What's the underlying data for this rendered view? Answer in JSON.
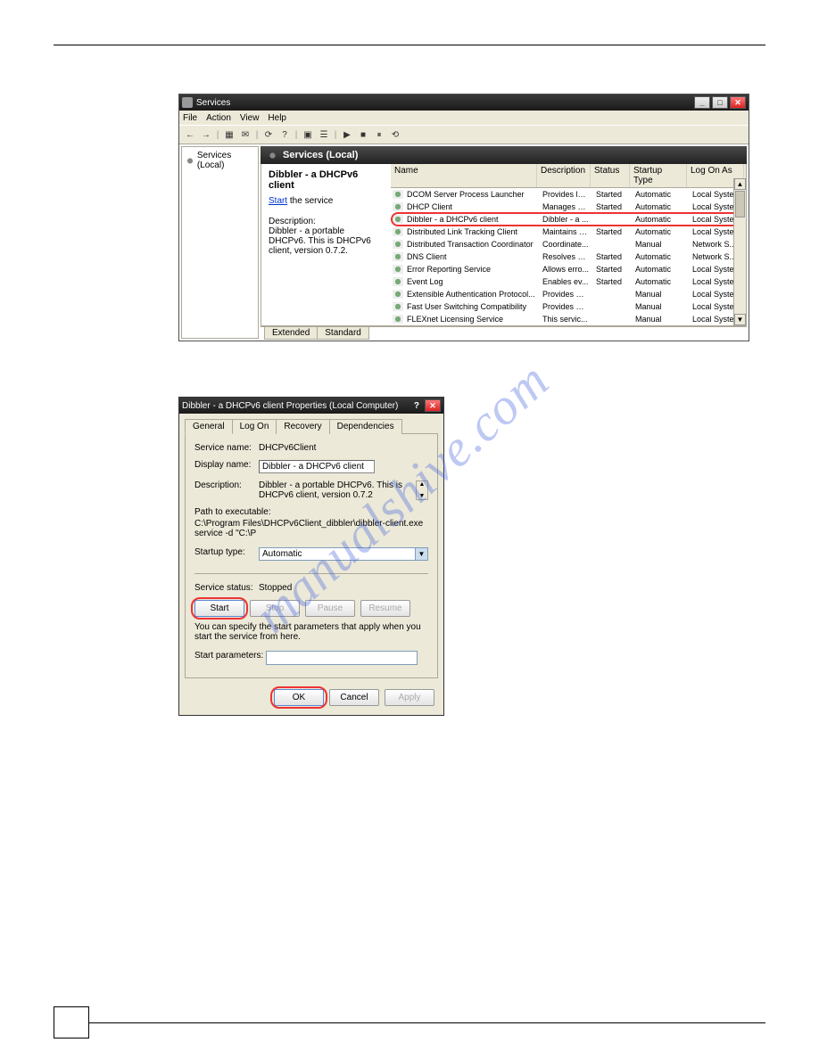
{
  "services_window": {
    "title": "Services",
    "menus": [
      "File",
      "Action",
      "View",
      "Help"
    ],
    "tree_root": "Services (Local)",
    "panel_header": "Services (Local)",
    "item_title": "Dibbler - a DHCPv6 client",
    "start_link": "Start",
    "start_suffix": " the service",
    "desc_label": "Description:",
    "desc_text": "Dibbler - a portable DHCPv6. This is DHCPv6 client, version 0.7.2.",
    "columns": {
      "name": "Name",
      "desc": "Description",
      "status": "Status",
      "startup": "Startup Type",
      "logon": "Log On As"
    },
    "rows": [
      {
        "name": "DCOM Server Process Launcher",
        "desc": "Provides la...",
        "status": "Started",
        "startup": "Automatic",
        "logon": "Local System"
      },
      {
        "name": "DHCP Client",
        "desc": "Manages n...",
        "status": "Started",
        "startup": "Automatic",
        "logon": "Local System"
      },
      {
        "name": "Dibbler - a DHCPv6 client",
        "desc": "Dibbler - a ...",
        "status": "",
        "startup": "Automatic",
        "logon": "Local System",
        "highlight": true
      },
      {
        "name": "Distributed Link Tracking Client",
        "desc": "Maintains li...",
        "status": "Started",
        "startup": "Automatic",
        "logon": "Local System"
      },
      {
        "name": "Distributed Transaction Coordinator",
        "desc": "Coordinate...",
        "status": "",
        "startup": "Manual",
        "logon": "Network S..."
      },
      {
        "name": "DNS Client",
        "desc": "Resolves a...",
        "status": "Started",
        "startup": "Automatic",
        "logon": "Network S..."
      },
      {
        "name": "Error Reporting Service",
        "desc": "Allows erro...",
        "status": "Started",
        "startup": "Automatic",
        "logon": "Local System"
      },
      {
        "name": "Event Log",
        "desc": "Enables ev...",
        "status": "Started",
        "startup": "Automatic",
        "logon": "Local System"
      },
      {
        "name": "Extensible Authentication Protocol...",
        "desc": "Provides wi...",
        "status": "",
        "startup": "Manual",
        "logon": "Local System"
      },
      {
        "name": "Fast User Switching Compatibility",
        "desc": "Provides m...",
        "status": "",
        "startup": "Manual",
        "logon": "Local System"
      },
      {
        "name": "FLEXnet Licensing Service",
        "desc": "This servic...",
        "status": "",
        "startup": "Manual",
        "logon": "Local System"
      }
    ],
    "tabs": {
      "extended": "Extended",
      "standard": "Standard"
    }
  },
  "props_dialog": {
    "title": "Dibbler - a DHCPv6 client Properties (Local Computer)",
    "tabs": [
      "General",
      "Log On",
      "Recovery",
      "Dependencies"
    ],
    "fields": {
      "service_name_label": "Service name:",
      "service_name": "DHCPv6Client",
      "display_name_label": "Display name:",
      "display_name": "Dibbler - a DHCPv6 client",
      "description_label": "Description:",
      "description": "Dibbler - a portable DHCPv6. This is DHCPv6 client, version 0.7.2",
      "path_label": "Path to executable:",
      "path": "C:\\Program Files\\DHCPv6Client_dibbler\\dibbler-client.exe service -d \"C:\\P",
      "startup_label": "Startup type:",
      "startup_value": "Automatic",
      "status_label": "Service status:",
      "status_value": "Stopped",
      "start_params_label": "Start parameters:",
      "note": "You can specify the start parameters that apply when you start the service from here."
    },
    "buttons": {
      "start": "Start",
      "stop": "Stop",
      "pause": "Pause",
      "resume": "Resume",
      "ok": "OK",
      "cancel": "Cancel",
      "apply": "Apply"
    }
  },
  "watermark": "manualshive.com"
}
